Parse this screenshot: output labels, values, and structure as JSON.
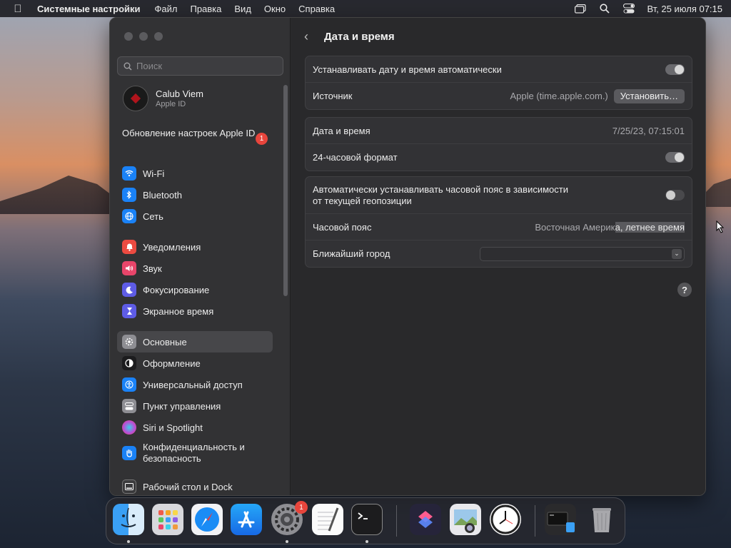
{
  "menubar": {
    "app_name": "Системные настройки",
    "menus": [
      "Файл",
      "Правка",
      "Вид",
      "Окно",
      "Справка"
    ],
    "datetime": "Вт, 25 июля  07:15"
  },
  "sidebar": {
    "search_placeholder": "Поиск",
    "account": {
      "name": "Calub Viem",
      "subtitle": "Apple ID"
    },
    "update": {
      "label": "Обновление настроек Apple ID",
      "badge": "1"
    },
    "groups": [
      [
        {
          "label": "Wi-Fi",
          "icon": "wifi-icon",
          "color": "#1a82f7"
        },
        {
          "label": "Bluetooth",
          "icon": "bluetooth-icon",
          "color": "#1a82f7"
        },
        {
          "label": "Сеть",
          "icon": "globe-icon",
          "color": "#1a82f7"
        }
      ],
      [
        {
          "label": "Уведомления",
          "icon": "bell-icon",
          "color": "#ec4b41"
        },
        {
          "label": "Звук",
          "icon": "speaker-icon",
          "color": "#e8456a"
        },
        {
          "label": "Фокусирование",
          "icon": "moon-icon",
          "color": "#5e5ce6"
        },
        {
          "label": "Экранное время",
          "icon": "hourglass-icon",
          "color": "#5e5ce6"
        }
      ],
      [
        {
          "label": "Основные",
          "icon": "gear-icon",
          "color": "#8e8e93",
          "selected": true
        },
        {
          "label": "Оформление",
          "icon": "appearance-icon",
          "color": "#1c1c1e"
        },
        {
          "label": "Универсальный доступ",
          "icon": "accessibility-icon",
          "color": "#1a82f7"
        },
        {
          "label": "Пункт управления",
          "icon": "control-center-icon",
          "color": "#8e8e93"
        },
        {
          "label": "Siri и Spotlight",
          "icon": "siri-icon",
          "color": "#b84fd6"
        },
        {
          "label": "Конфиденциальность и безопасность",
          "icon": "hand-icon",
          "color": "#1a82f7"
        }
      ],
      [
        {
          "label": "Рабочий стол и Dock",
          "icon": "dock-icon",
          "color": "#3a3a3c"
        }
      ]
    ]
  },
  "main": {
    "back_label": "‹",
    "title": "Дата и время",
    "auto_datetime_label": "Устанавливать дату и время автоматически",
    "auto_datetime_on": true,
    "source_label": "Источник",
    "source_value": "Apple (time.apple.com.)",
    "set_button": "Установить…",
    "datetime_label": "Дата и время",
    "datetime_value": "7/25/23, 07:15:01",
    "format24_label": "24-часовой формат",
    "format24_on": true,
    "auto_tz_label_line1": "Автоматически устанавливать часовой пояс в зависимости",
    "auto_tz_label_line2": "от текущей геопозиции",
    "auto_tz_on": false,
    "tz_label": "Часовой пояс",
    "tz_value_plain": "Восточная Америк",
    "tz_value_selected": "а, летнее время",
    "city_label": "Ближайший город",
    "city_value": "",
    "help": "?"
  },
  "dock": {
    "settings_badge": "1",
    "apps": [
      {
        "name": "Finder",
        "icon": "finder-icon"
      },
      {
        "name": "Launchpad",
        "icon": "launchpad-icon"
      },
      {
        "name": "Safari",
        "icon": "safari-icon"
      },
      {
        "name": "App Store",
        "icon": "app-store-icon"
      },
      {
        "name": "System Settings",
        "icon": "system-settings-icon"
      },
      {
        "name": "TextEdit",
        "icon": "textedit-icon"
      },
      {
        "name": "Terminal",
        "icon": "terminal-icon"
      },
      {
        "name": "Shortcuts",
        "icon": "shortcuts-icon"
      },
      {
        "name": "Preview",
        "icon": "preview-icon"
      },
      {
        "name": "Clock",
        "icon": "clock-icon"
      },
      {
        "name": "Downloads",
        "icon": "downloads-stack-icon"
      },
      {
        "name": "Trash",
        "icon": "trash-icon"
      }
    ]
  }
}
